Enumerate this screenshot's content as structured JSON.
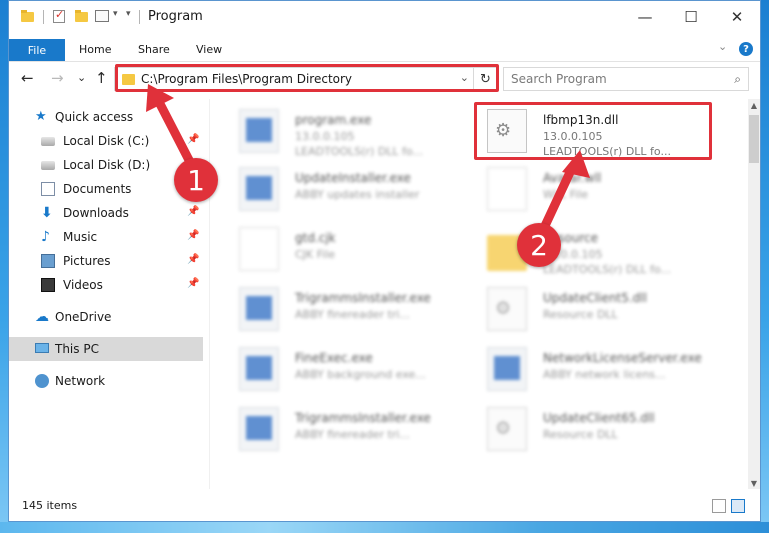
{
  "window": {
    "title": "Program",
    "minimize": "—",
    "maximize": "☐",
    "close": "✕"
  },
  "ribbon": {
    "tabs": [
      "File",
      "Home",
      "Share",
      "View"
    ],
    "expand": "⌄",
    "help": "?"
  },
  "nav": {
    "back": "←",
    "forward": "→",
    "recent": "⌄",
    "up": "↑",
    "address": "C:\\Program Files\\Program Directory",
    "address_dropdown": "⌄",
    "refresh": "↻",
    "search_placeholder": "Search Program",
    "search_icon": "⌕"
  },
  "sidebar": {
    "items": [
      {
        "label": "Quick access",
        "icon": "star-icon"
      },
      {
        "label": "Local Disk (C:)",
        "icon": "disk-icon",
        "pinned": true
      },
      {
        "label": "Local Disk (D:)",
        "icon": "disk-icon",
        "pinned": false
      },
      {
        "label": "Documents",
        "icon": "documents-icon",
        "pinned": true
      },
      {
        "label": "Downloads",
        "icon": "download-icon",
        "pinned": true
      },
      {
        "label": "Music",
        "icon": "music-icon",
        "pinned": true
      },
      {
        "label": "Pictures",
        "icon": "pictures-icon",
        "pinned": true
      },
      {
        "label": "Videos",
        "icon": "videos-icon",
        "pinned": true
      },
      {
        "label": "OneDrive",
        "icon": "cloud-icon"
      },
      {
        "label": "This PC",
        "icon": "computer-icon",
        "selected": true
      },
      {
        "label": "Network",
        "icon": "network-icon"
      }
    ],
    "pin_glyph": "📌"
  },
  "files": [
    {
      "name": "program.exe",
      "meta1": "13.0.0.105",
      "meta2": "LEADTOOLS(r) DLL fo...",
      "type": "exe",
      "blurred": true
    },
    {
      "name": "lfbmp13n.dll",
      "meta1": "13.0.0.105",
      "meta2": "LEADTOOLS(r) DLL fo...",
      "type": "dll",
      "blurred": false
    },
    {
      "name": "UpdateInstaller.exe",
      "meta1": "ABBY updates installer",
      "meta2": "",
      "type": "exe",
      "blurred": true
    },
    {
      "name": "Avatar.wll",
      "meta1": "WLL File",
      "meta2": "",
      "type": "doc",
      "blurred": true
    },
    {
      "name": "gtd.cjk",
      "meta1": "CJK File",
      "meta2": "",
      "type": "doc",
      "blurred": true
    },
    {
      "name": "Resource",
      "meta1": "13.0.0.105",
      "meta2": "LEADTOOLS(r) DLL fo...",
      "type": "folder",
      "blurred": true
    },
    {
      "name": "TrigrammsInstaller.exe",
      "meta1": "ABBY finereader tri...",
      "meta2": "",
      "type": "exe",
      "blurred": true
    },
    {
      "name": "UpdateClient5.dll",
      "meta1": "Resource DLL",
      "meta2": "",
      "type": "dll",
      "blurred": true
    },
    {
      "name": "FineExec.exe",
      "meta1": "ABBY background exe...",
      "meta2": "",
      "type": "exe",
      "blurred": true
    },
    {
      "name": "NetworkLicenseServer.exe",
      "meta1": "ABBY network licens...",
      "meta2": "",
      "type": "exe",
      "blurred": true
    },
    {
      "name": "TrigrammsInstaller.exe",
      "meta1": "ABBY finereader tri...",
      "meta2": "",
      "type": "exe",
      "blurred": true
    },
    {
      "name": "UpdateClient65.dll",
      "meta1": "Resource DLL",
      "meta2": "",
      "type": "dll",
      "blurred": true
    }
  ],
  "status": {
    "count": "145 items"
  },
  "callouts": [
    "1",
    "2"
  ],
  "colors": {
    "accent": "#1979ca",
    "highlight": "#e0313a"
  }
}
